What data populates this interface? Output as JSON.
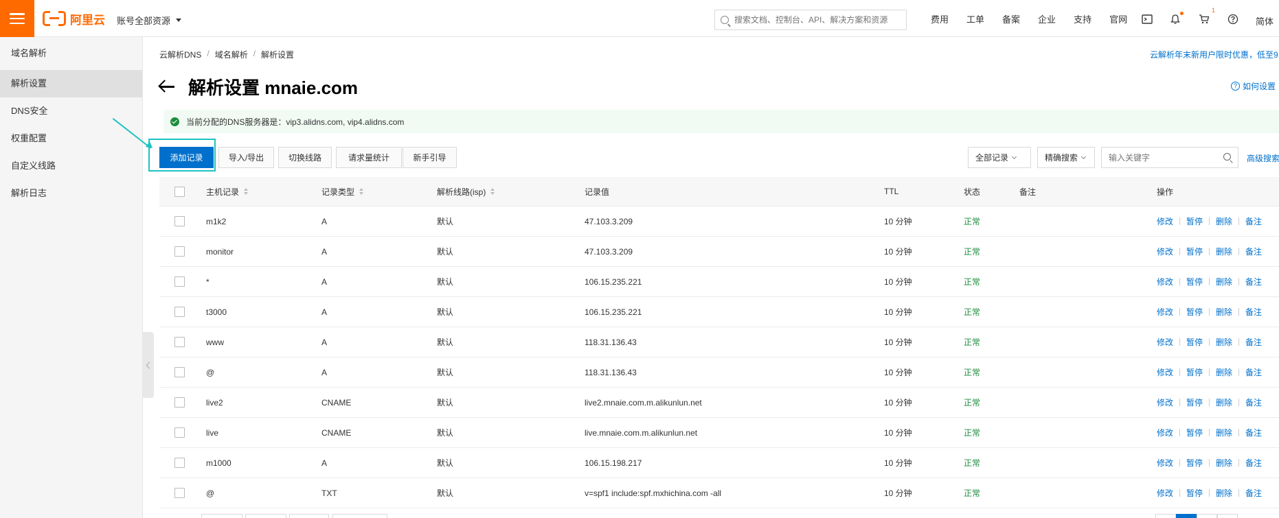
{
  "topbar": {
    "logo_text": "阿里云",
    "account_label": "账号全部资源",
    "search_placeholder": "搜索文档、控制台、API、解决方案和资源",
    "nav": [
      "费用",
      "工单",
      "备案",
      "企业",
      "支持",
      "官网"
    ],
    "cart_badge": "1",
    "language": "简体"
  },
  "sidebar": {
    "title": "域名解析",
    "items": [
      {
        "label": "解析设置",
        "active": true
      },
      {
        "label": "DNS安全",
        "active": false
      },
      {
        "label": "权重配置",
        "active": false
      },
      {
        "label": "自定义线路",
        "active": false
      },
      {
        "label": "解析日志",
        "active": false
      }
    ]
  },
  "breadcrumb": [
    "云解析DNS",
    "域名解析",
    "解析设置"
  ],
  "promo_text": "云解析年末新用户限时优惠，低至9",
  "page_title": "解析设置 mnaie.com",
  "howto_label": "如何设置",
  "notice": "当前分配的DNS服务器是：vip3.alidns.com, vip4.alidns.com",
  "toolbar": {
    "add_label": "添加记录",
    "import_export_label": "导入/导出",
    "switch_line_label": "切换线路",
    "request_stats_label": "请求量统计",
    "guide_label": "新手引导",
    "filter_all_label": "全部记录",
    "exact_search_label": "精确搜索",
    "keyword_placeholder": "输入关键字",
    "advanced_search_label": "高级搜索"
  },
  "table": {
    "headers": {
      "host": "主机记录",
      "type": "记录类型",
      "line": "解析线路(isp)",
      "value": "记录值",
      "ttl": "TTL",
      "status": "状态",
      "remark": "备注",
      "ops": "操作"
    },
    "op_labels": {
      "edit": "修改",
      "pause": "暂停",
      "delete": "删除",
      "remark": "备注"
    },
    "rows": [
      {
        "host": "m1k2",
        "type": "A",
        "line": "默认",
        "value": "47.103.3.209",
        "ttl": "10 分钟",
        "status": "正常"
      },
      {
        "host": "monitor",
        "type": "A",
        "line": "默认",
        "value": "47.103.3.209",
        "ttl": "10 分钟",
        "status": "正常"
      },
      {
        "host": "*",
        "type": "A",
        "line": "默认",
        "value": "106.15.235.221",
        "ttl": "10 分钟",
        "status": "正常"
      },
      {
        "host": "t3000",
        "type": "A",
        "line": "默认",
        "value": "106.15.235.221",
        "ttl": "10 分钟",
        "status": "正常"
      },
      {
        "host": "www",
        "type": "A",
        "line": "默认",
        "value": "118.31.136.43",
        "ttl": "10 分钟",
        "status": "正常"
      },
      {
        "host": "@",
        "type": "A",
        "line": "默认",
        "value": "118.31.136.43",
        "ttl": "10 分钟",
        "status": "正常"
      },
      {
        "host": "live2",
        "type": "CNAME",
        "line": "默认",
        "value": "live2.mnaie.com.m.alikunlun.net",
        "ttl": "10 分钟",
        "status": "正常"
      },
      {
        "host": "live",
        "type": "CNAME",
        "line": "默认",
        "value": "live.mnaie.com.m.alikunlun.net",
        "ttl": "10 分钟",
        "status": "正常"
      },
      {
        "host": "m1000",
        "type": "A",
        "line": "默认",
        "value": "106.15.198.217",
        "ttl": "10 分钟",
        "status": "正常"
      },
      {
        "host": "@",
        "type": "TXT",
        "line": "默认",
        "value": "v=spf1 include:spf.mxhichina.com -all",
        "ttl": "10 分钟",
        "status": "正常"
      }
    ]
  },
  "colors": {
    "accent": "#ff6a00",
    "primary": "#0070cc",
    "success": "#1e8e3e",
    "highlight": "#1fc2c2"
  }
}
